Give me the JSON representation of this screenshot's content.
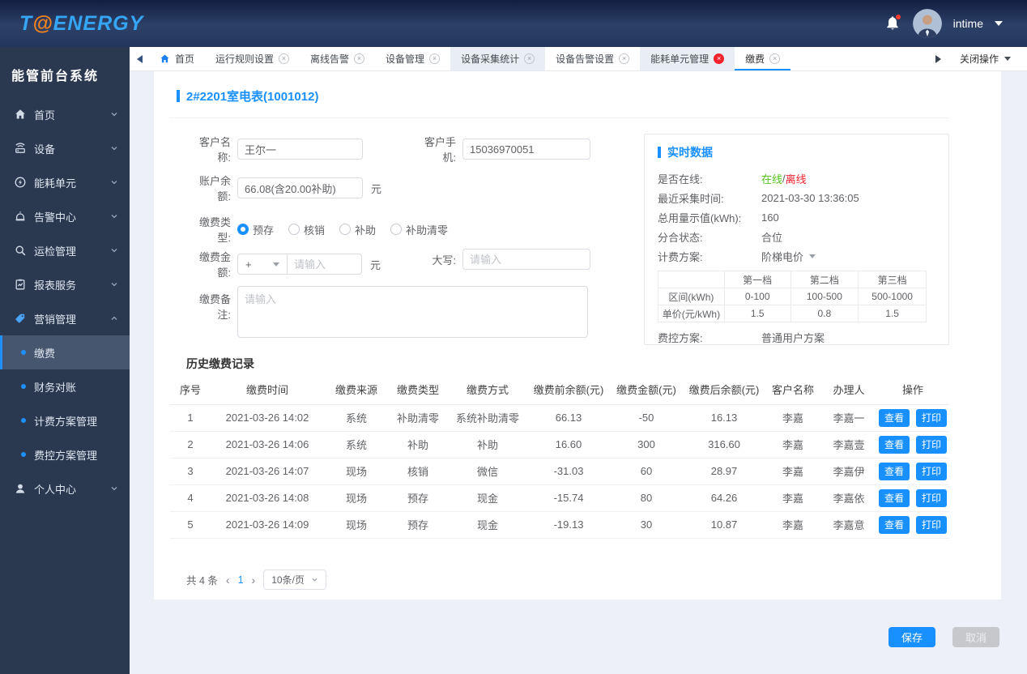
{
  "navbar": {
    "logo_t": "T",
    "logo_at": "@",
    "logo_energy": "ENERGY",
    "username": "intime"
  },
  "tabbar": {
    "home_label": "首页",
    "tabs": [
      {
        "label": "运行规则设置"
      },
      {
        "label": "离线告警"
      },
      {
        "label": "设备管理"
      },
      {
        "label": "设备采集统计"
      },
      {
        "label": "设备告警设置"
      },
      {
        "label": "能耗单元管理"
      },
      {
        "label": "缴费"
      }
    ],
    "close_actions": "关闭操作"
  },
  "glyphs": {
    "close": "×",
    "prev": "‹",
    "next": "›"
  },
  "sidebar": {
    "title": "能管前台系统",
    "items": [
      {
        "label": "首页",
        "icon": "home-icon"
      },
      {
        "label": "设备",
        "icon": "device-icon"
      },
      {
        "label": "能耗单元",
        "icon": "energy-unit-icon"
      },
      {
        "label": "告警中心",
        "icon": "alarm-icon"
      },
      {
        "label": "运检管理",
        "icon": "inspection-icon"
      },
      {
        "label": "报表服务",
        "icon": "report-icon"
      },
      {
        "label": "营销管理",
        "icon": "marketing-icon"
      },
      {
        "label": "个人中心",
        "icon": "user-icon"
      }
    ],
    "submenu": [
      {
        "label": "缴费"
      },
      {
        "label": "财务对账"
      },
      {
        "label": "计费方案管理"
      },
      {
        "label": "费控方案管理"
      }
    ]
  },
  "page": {
    "title": "2#2201室电表(1001012)"
  },
  "form": {
    "customer_name": {
      "label": "客户名称:",
      "value": "王尔一"
    },
    "customer_phone": {
      "label": "客户手机:",
      "value": "15036970051"
    },
    "balance": {
      "label": "账户余额:",
      "value": "66.08(含20.00补助)",
      "unit": "元"
    },
    "pay_type": {
      "label": "缴费类型:",
      "options": [
        "预存",
        "核销",
        "补助",
        "补助清零"
      ],
      "selected": "预存"
    },
    "pay_amount": {
      "label": "缴费金额:",
      "sign": "+",
      "placeholder": "请输入",
      "unit": "元"
    },
    "capital": {
      "label": "大写:",
      "placeholder": "请输入"
    },
    "remark": {
      "label": "缴费备注:",
      "placeholder": "请输入"
    }
  },
  "realtime": {
    "title": "实时数据",
    "online": {
      "label": "是否在线:",
      "online_text": "在线",
      "separator": "/",
      "offline_text": "离线"
    },
    "collect_time": {
      "label": "最近采集时间:",
      "value": "2021-03-30 13:36:05"
    },
    "total_usage": {
      "label": "总用量示值(kWh):",
      "value": "160"
    },
    "switch_state": {
      "label": "分合状态:",
      "value": "合位"
    },
    "billing_plan": {
      "label": "计费方案:",
      "value": "阶梯电价"
    },
    "tier_table": {
      "headers": [
        "第一档",
        "第二档",
        "第三档"
      ],
      "row_interval": {
        "label": "区间(kWh)",
        "values": [
          "0-100",
          "100-500",
          "500-1000"
        ]
      },
      "row_price": {
        "label": "单价(元/kWh)",
        "values": [
          "1.5",
          "0.8",
          "1.5"
        ]
      }
    },
    "fee_control": {
      "label": "费控方案:",
      "value": "普通用户方案"
    }
  },
  "history": {
    "title": "历史缴费记录",
    "columns": [
      "序号",
      "缴费时间",
      "缴费来源",
      "缴费类型",
      "缴费方式",
      "缴费前余额(元)",
      "缴费金额(元)",
      "缴费后余额(元)",
      "客户名称",
      "办理人",
      "操作"
    ],
    "rows": [
      [
        "1",
        "2021-03-26 14:02",
        "系统",
        "补助清零",
        "系统补助清零",
        "66.13",
        "-50",
        "16.13",
        "李嘉",
        "李嘉一"
      ],
      [
        "2",
        "2021-03-26 14:06",
        "系统",
        "补助",
        "补助",
        "16.60",
        "300",
        "316.60",
        "李嘉",
        "李嘉壹"
      ],
      [
        "3",
        "2021-03-26 14:07",
        "现场",
        "核销",
        "微信",
        "-31.03",
        "60",
        "28.97",
        "李嘉",
        "李嘉伊"
      ],
      [
        "4",
        "2021-03-26 14:08",
        "现场",
        "预存",
        "现金",
        "-15.74",
        "80",
        "64.26",
        "李嘉",
        "李嘉依"
      ],
      [
        "5",
        "2021-03-26 14:09",
        "现场",
        "预存",
        "现金",
        "-19.13",
        "30",
        "10.87",
        "李嘉",
        "李嘉意"
      ]
    ],
    "view_label": "查看",
    "print_label": "打印"
  },
  "pagination": {
    "total": "共 4 条",
    "page": "1",
    "page_size": "10条/页"
  },
  "footer": {
    "save": "保存",
    "cancel": "取消"
  },
  "colors": {
    "primary": "#1890ff",
    "online_green": "#52c41a",
    "offline_red": "#f5222d",
    "navbar": "#2d4168",
    "sidebar": "#2a3950"
  }
}
